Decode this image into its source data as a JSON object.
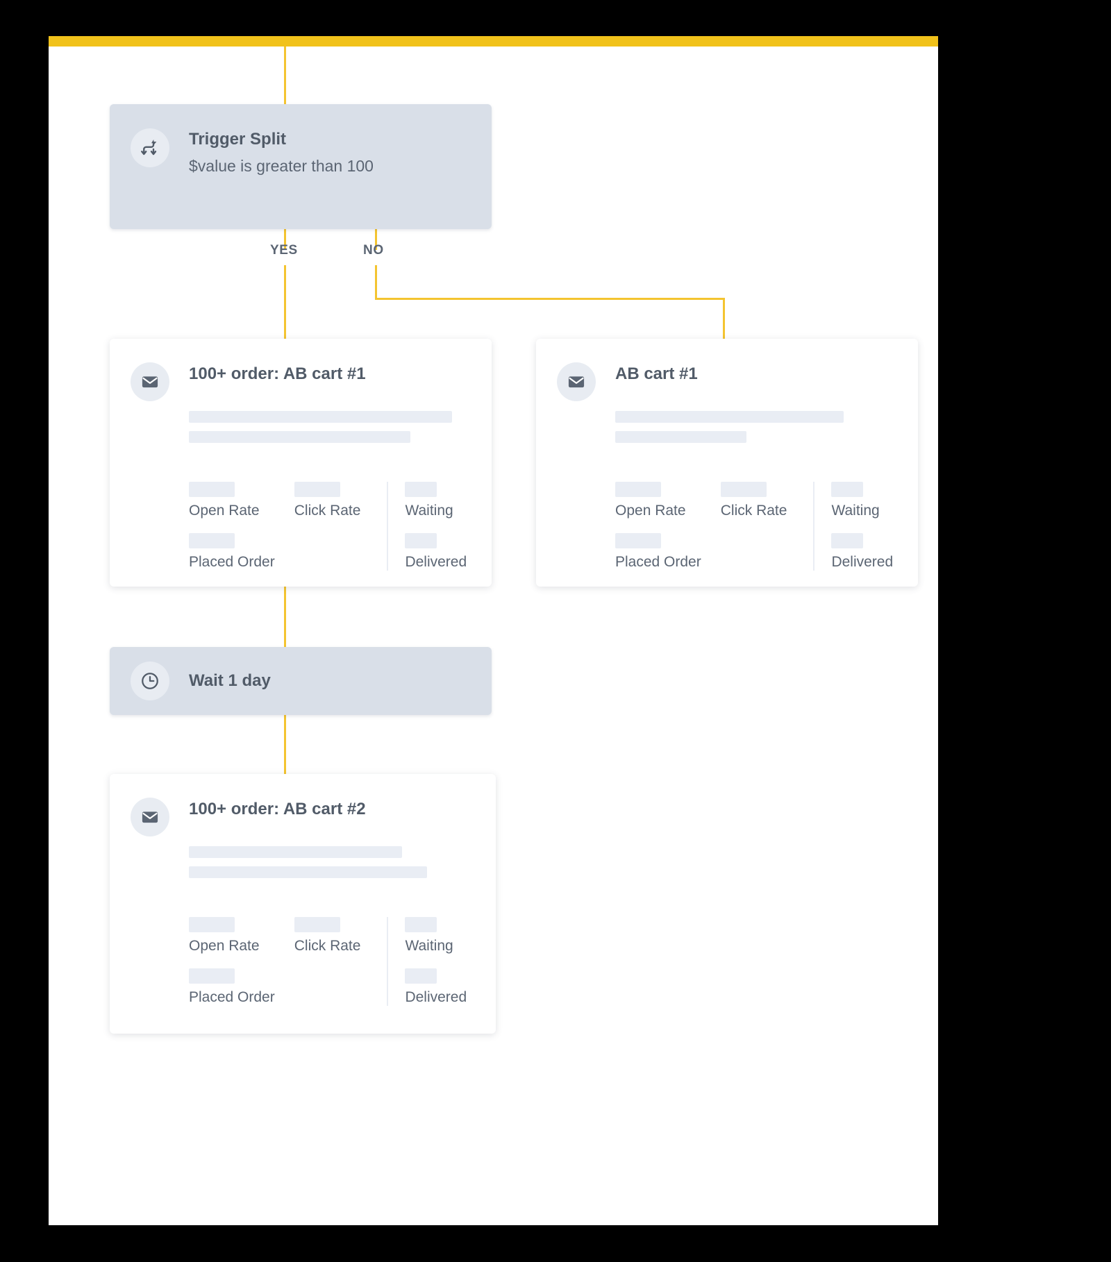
{
  "theme": {
    "background": "#000000",
    "panel_background": "#ffffff",
    "accent_bar": "#f1c21b",
    "connector": "#f4c430",
    "node_grey": "#d9dfe8",
    "skeleton": "#e9edf4",
    "text": "#5b6573"
  },
  "flow": {
    "branch_labels": {
      "yes": "YES",
      "no": "NO"
    },
    "nodes": {
      "trigger": {
        "icon": "trigger-split-icon",
        "title": "Trigger Split",
        "subtitle": "$value is greater than 100"
      },
      "wait": {
        "icon": "clock-icon",
        "title": "Wait 1 day"
      },
      "email_a": {
        "icon": "envelope-icon",
        "title": "100+ order: AB cart #1",
        "stats_left": [
          {
            "label": "Open Rate"
          },
          {
            "label": "Click Rate"
          },
          {
            "label": "Placed Order"
          }
        ],
        "stats_right": [
          {
            "label": "Waiting"
          },
          {
            "label": "Delivered"
          }
        ]
      },
      "email_b": {
        "icon": "envelope-icon",
        "title": "AB cart #1",
        "stats_left": [
          {
            "label": "Open Rate"
          },
          {
            "label": "Click Rate"
          },
          {
            "label": "Placed Order"
          }
        ],
        "stats_right": [
          {
            "label": "Waiting"
          },
          {
            "label": "Delivered"
          }
        ]
      },
      "email_c": {
        "icon": "envelope-icon",
        "title": "100+ order: AB cart #2",
        "stats_left": [
          {
            "label": "Open Rate"
          },
          {
            "label": "Click Rate"
          },
          {
            "label": "Placed Order"
          }
        ],
        "stats_right": [
          {
            "label": "Waiting"
          },
          {
            "label": "Delivered"
          }
        ]
      }
    }
  }
}
